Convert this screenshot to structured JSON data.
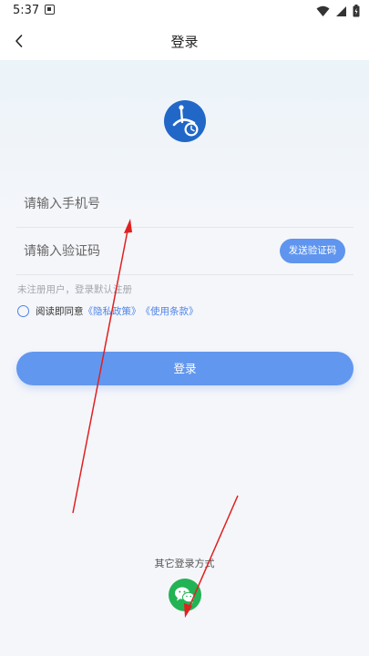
{
  "status_bar": {
    "time": "5:37"
  },
  "header": {
    "title": "登录",
    "back_icon": "chevron-left-icon"
  },
  "form": {
    "phone_placeholder": "请输入手机号",
    "phone_value": "",
    "code_placeholder": "请输入验证码",
    "code_value": "",
    "send_code_label": "发送验证码",
    "hint": "未注册用户，登录默认注册",
    "agreement_prefix": "阅读即同意",
    "privacy_link": "《隐私政策》",
    "terms_link": "《使用条款》",
    "login_label": "登录"
  },
  "other_login": {
    "label": "其它登录方式",
    "icon": "wechat-icon"
  },
  "colors": {
    "accent": "#6297ef",
    "link": "#4d84e8",
    "wechat": "#22b354",
    "annotation": "#e02020",
    "logo": "#2167c8"
  }
}
